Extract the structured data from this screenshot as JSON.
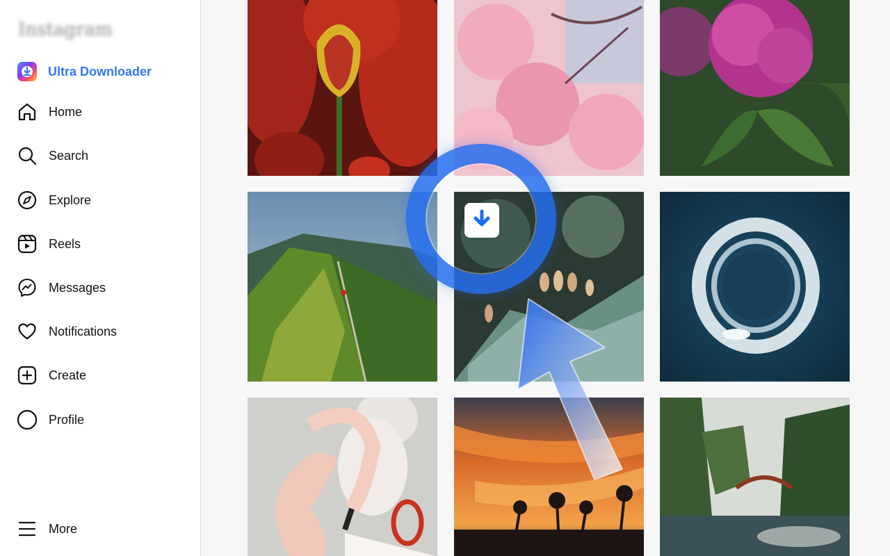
{
  "sidebar": {
    "logo_text": "Instagram",
    "extension": {
      "label": "Ultra Downloader",
      "icon": "download-icon",
      "color": "#3478f6"
    },
    "items": [
      {
        "label": "Home",
        "icon": "home-icon"
      },
      {
        "label": "Search",
        "icon": "search-icon"
      },
      {
        "label": "Explore",
        "icon": "compass-icon"
      },
      {
        "label": "Reels",
        "icon": "reels-icon"
      },
      {
        "label": "Messages",
        "icon": "messenger-icon"
      },
      {
        "label": "Notifications",
        "icon": "heart-icon"
      },
      {
        "label": "Create",
        "icon": "plus-square-icon"
      },
      {
        "label": "Profile",
        "icon": "profile-circle-icon"
      }
    ],
    "more": {
      "label": "More",
      "icon": "menu-icon"
    }
  },
  "feed": {
    "posts": [
      {
        "subject": "red tulips"
      },
      {
        "subject": "pink cherry blossoms"
      },
      {
        "subject": "magenta rhododendron"
      },
      {
        "subject": "green mountain ridge trail"
      },
      {
        "subject": "spruce branches with cones"
      },
      {
        "subject": "boat wake circle in ocean"
      },
      {
        "subject": "painted woman with flamingo"
      },
      {
        "subject": "orange sunset with palm trees"
      },
      {
        "subject": "forest bridge over river"
      }
    ]
  },
  "overlay": {
    "download_button_icon": "arrow-down-icon",
    "ring_color": "#266eee",
    "cursor_icon": "pointer-arrow-icon"
  }
}
